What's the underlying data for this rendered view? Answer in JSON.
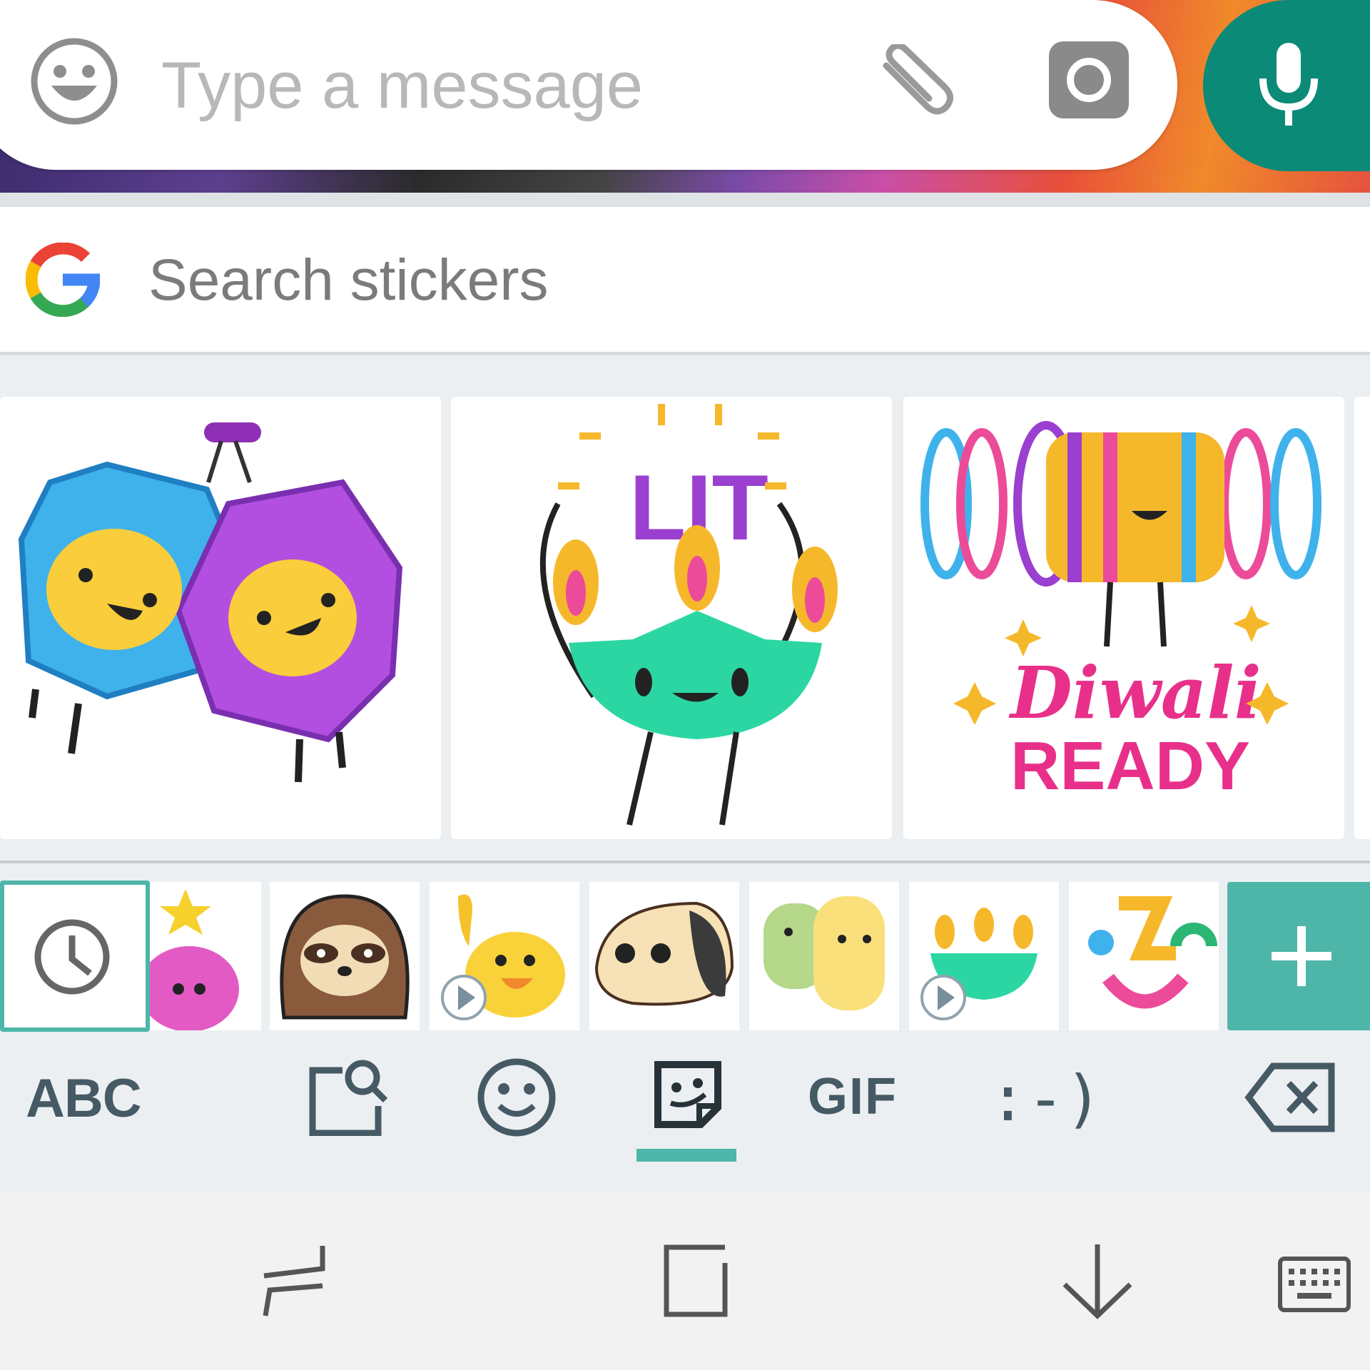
{
  "composer": {
    "placeholder": "Type a message",
    "emoji_icon": "smiley-face-icon",
    "attach_icon": "paperclip-icon",
    "camera_icon": "camera-icon",
    "mic_icon": "microphone-icon",
    "mic_color": "#0b8a78"
  },
  "sticker_search": {
    "logo": "google-g-icon",
    "placeholder": "Search stickers"
  },
  "stickers": [
    {
      "name": "lanterns-sticker"
    },
    {
      "name": "lit-diya-sticker",
      "text": "LIT"
    },
    {
      "name": "diwali-ready-bangles-sticker",
      "text_line1": "Diwali",
      "text_line2": "READY"
    }
  ],
  "packs": [
    {
      "name": "recent-pack",
      "icon": "clock-icon",
      "selected": true
    },
    {
      "name": "star-blob-pack"
    },
    {
      "name": "sloth-pack"
    },
    {
      "name": "yellow-bird-pack",
      "animated": true
    },
    {
      "name": "taco-pack"
    },
    {
      "name": "hugging-toast-pack"
    },
    {
      "name": "diya-pack",
      "animated": true
    },
    {
      "name": "face-shapes-pack"
    },
    {
      "name": "add-pack",
      "icon": "plus-icon",
      "color": "#4db6a8"
    }
  ],
  "toolbar": {
    "abc_label": "ABC",
    "gif_label": "GIF",
    "emoticon_label": ":-)",
    "active_tab": "stickers",
    "accent": "#4db6a8",
    "icon_color": "#455a64"
  },
  "navbar": {
    "icons": [
      "recent-apps-icon",
      "home-icon",
      "back-icon",
      "keyboard-icon"
    ]
  }
}
